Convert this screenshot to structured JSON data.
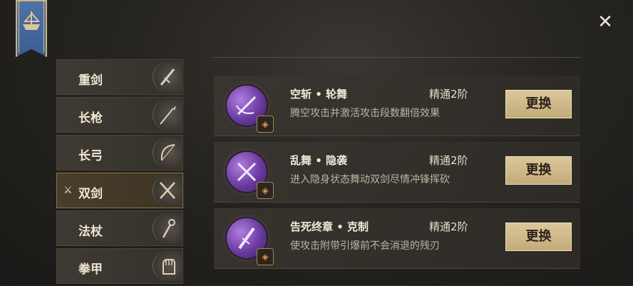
{
  "weapons": [
    {
      "label": "重剑",
      "icon": "greatsword-icon",
      "active": false
    },
    {
      "label": "长枪",
      "icon": "spear-icon",
      "active": false
    },
    {
      "label": "长弓",
      "icon": "longbow-icon",
      "active": false
    },
    {
      "label": "双剑",
      "icon": "dual-swords-icon",
      "active": true
    },
    {
      "label": "法杖",
      "icon": "staff-icon",
      "active": false
    },
    {
      "label": "拳甲",
      "icon": "gauntlet-icon",
      "active": false
    }
  ],
  "active_mark_icon": "crossed-swords-icon",
  "close_glyph": "✕",
  "skills": [
    {
      "name": "空斩 • 轮舞",
      "level": "精通2阶",
      "desc": "腾空攻击并激活攻击段数翻倍效果",
      "button": "更换",
      "icon": "sword-slash-icon"
    },
    {
      "name": "乱舞 • 隐袭",
      "level": "精通2阶",
      "desc": "进入隐身状态舞动双剑尽情冲锋挥砍",
      "button": "更换",
      "icon": "crossed-blades-icon"
    },
    {
      "name": "告死终章 • 克制",
      "level": "精通2阶",
      "desc": "使攻击附带引爆前不会消退的残刃",
      "button": "更换",
      "icon": "falling-sword-icon"
    }
  ],
  "colors": {
    "accent_gold": "#c9b27c",
    "skill_orb": "#8a55c4",
    "banner_blue": "#4669a0"
  }
}
